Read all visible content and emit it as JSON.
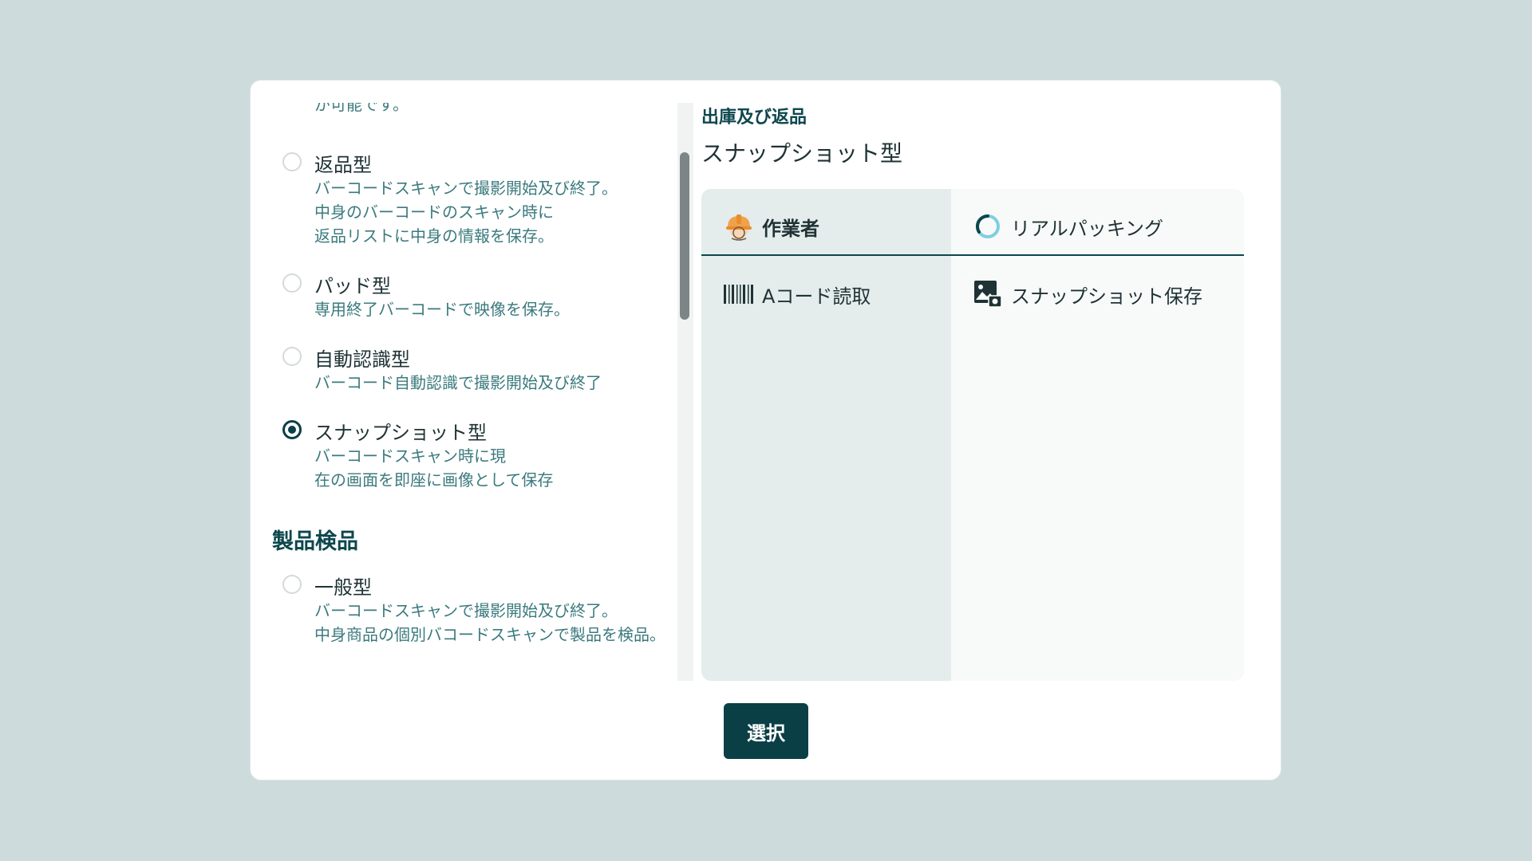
{
  "left": {
    "cut_text": "が可能です。",
    "options_a": [
      {
        "title": "返品型",
        "desc": [
          "バーコードスキャンで撮影開始及び終了。",
          "中身のバーコードのスキャン時に",
          " 返品リストに中身の情報を保存。"
        ],
        "checked": false
      },
      {
        "title": "パッド型",
        "desc": [
          "専用終了バーコードで映像を保存。"
        ],
        "checked": false
      },
      {
        "title": "自動認識型",
        "desc": [
          "バーコード自動認識で撮影開始及び終了"
        ],
        "checked": false
      },
      {
        "title": "スナップショット型",
        "desc": [
          "バーコードスキャン時に現",
          "在の画面を即座に画像として保存"
        ],
        "checked": true
      }
    ],
    "section2_title": "製品検品",
    "options_b": [
      {
        "title": "一般型",
        "desc": [
          "バーコードスキャンで撮影開始及び終了。",
          "中身商品の個別バコードスキャンで製品を検品。"
        ],
        "checked": false
      }
    ]
  },
  "right": {
    "section": "出庫及び返品",
    "type": "スナップショット型",
    "columns": [
      {
        "header": "作業者",
        "header_icon": "worker-helmet-icon",
        "step": "Aコード読取",
        "step_icon": "barcode-icon"
      },
      {
        "header": "リアルパッキング",
        "header_icon": "loading-ring-icon",
        "step": "スナップショット保存",
        "step_icon": "image-save-icon"
      }
    ]
  },
  "actions": {
    "select_label": "選択"
  },
  "colors": {
    "accent": "#0a3f46",
    "desc_text": "#3b7a7e",
    "background": "#cddbdc"
  }
}
